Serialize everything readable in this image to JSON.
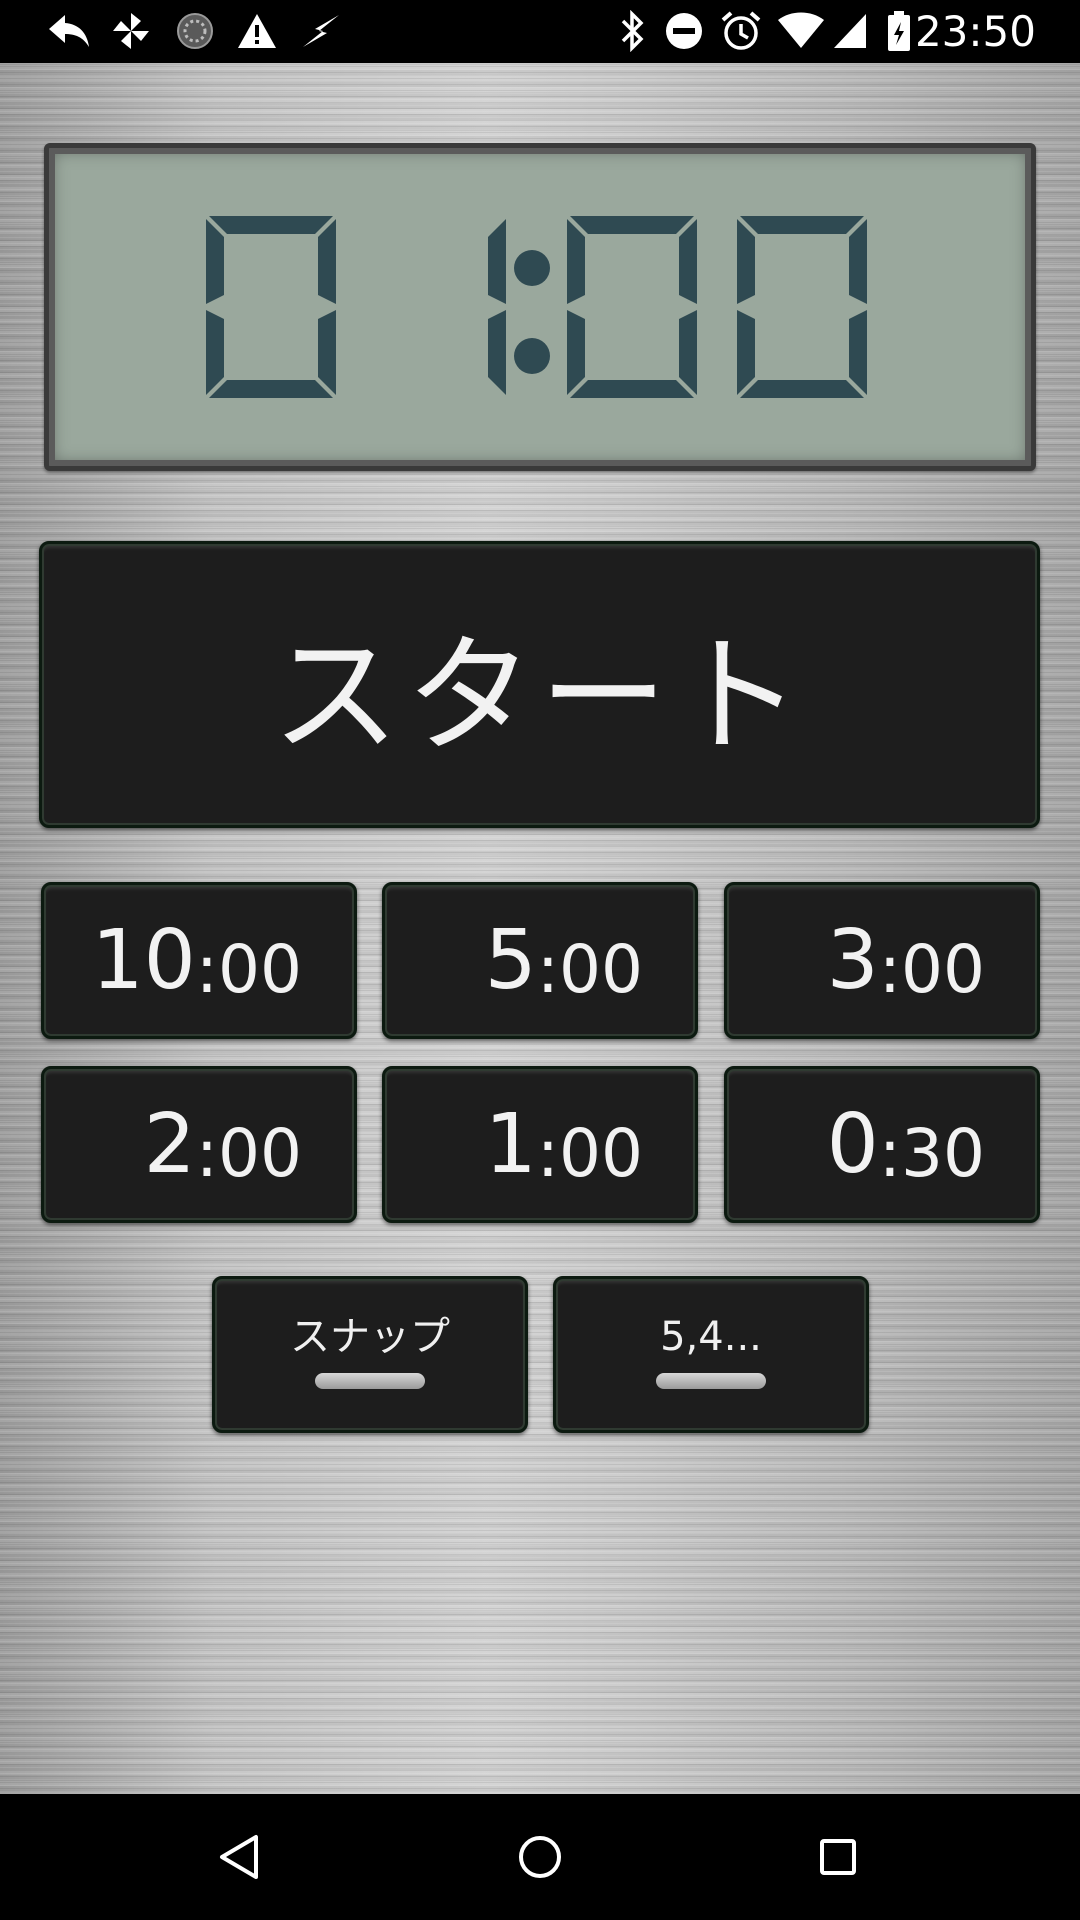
{
  "status_bar": {
    "time": "23:50",
    "left_icons": [
      "reply-icon",
      "pinwheel-icon",
      "loading-circle-icon",
      "warning-icon",
      "flash-icon"
    ],
    "right_icons": [
      "bluetooth-icon",
      "do-not-disturb-icon",
      "alarm-icon",
      "wifi-icon",
      "cell-signal-icon",
      "battery-charging-icon"
    ]
  },
  "display": {
    "time": "01:00",
    "lcd_background": "#9aa89d",
    "digit_color": "#2f4a52"
  },
  "start_button": {
    "label": "スタート"
  },
  "presets": [
    {
      "min": "10",
      "sec": ":00"
    },
    {
      "min": "5",
      "sec": ":00"
    },
    {
      "min": "3",
      "sec": ":00"
    },
    {
      "min": "2",
      "sec": ":00"
    },
    {
      "min": "1",
      "sec": ":00"
    },
    {
      "min": "0",
      "sec": ":30"
    }
  ],
  "mode_buttons": {
    "snap_label": "スナップ",
    "countdown_label": "5,4..."
  },
  "nav_bar": {
    "icons": [
      "back-icon",
      "home-icon",
      "recents-icon"
    ]
  }
}
